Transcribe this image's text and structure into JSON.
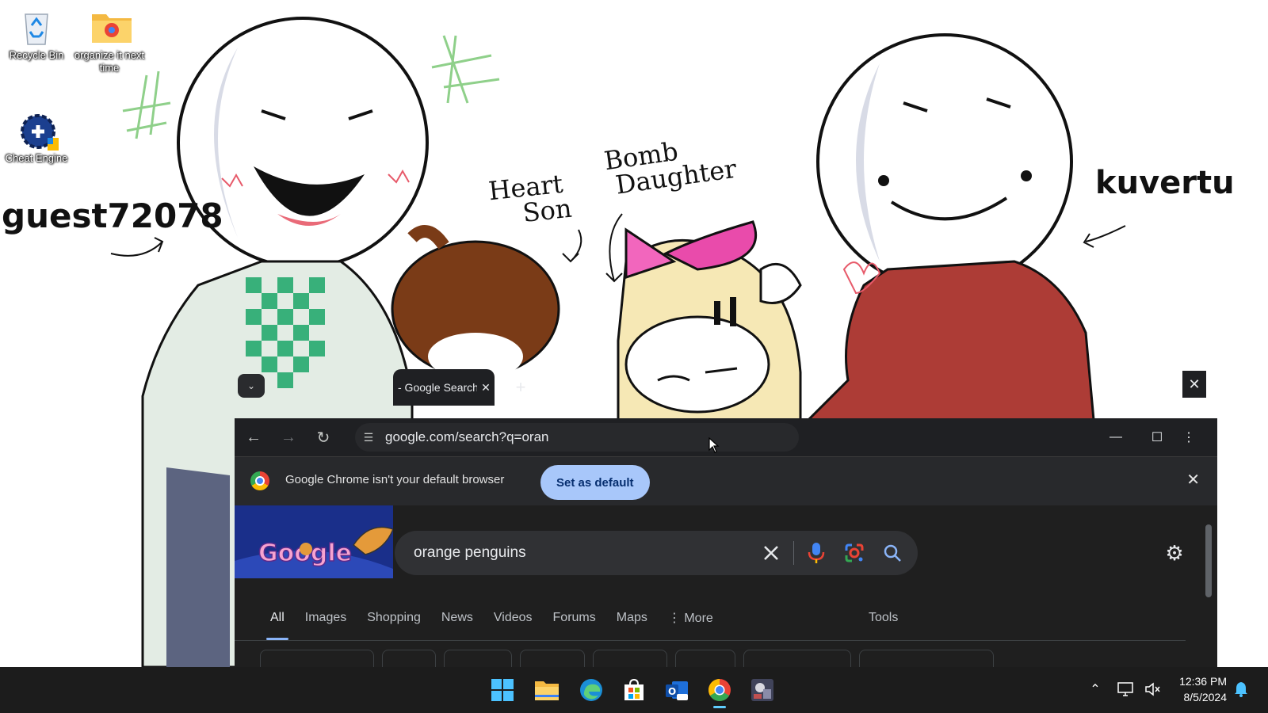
{
  "desktop": {
    "icons": [
      {
        "label": "Recycle Bin",
        "icon": "recycle-bin-icon"
      },
      {
        "label": "organize it next time",
        "icon": "folder-icon"
      },
      {
        "label": "Cheat Engine",
        "icon": "cheat-engine-icon"
      }
    ],
    "wallpaper": {
      "name_left": "guest72078",
      "name_right": "kuvertu",
      "heart_son": [
        "Heart",
        "Son"
      ],
      "bomb_daughter": [
        "Bomb",
        "Daughter"
      ]
    }
  },
  "browser": {
    "tab": {
      "title": "- Google Search",
      "close": "✕"
    },
    "new_tab": "+",
    "address": "google.com/search?q=oran",
    "infobar": {
      "message": "Google Chrome isn't your default browser",
      "button": "Set as default",
      "close": "✕"
    },
    "search": {
      "query": "orange penguins",
      "tabs": [
        "All",
        "Images",
        "Shopping",
        "News",
        "Videos",
        "Forums",
        "Maps",
        "⋮ More"
      ],
      "active_tab": "All",
      "tools": "Tools"
    }
  },
  "taskbar": {
    "apps": [
      "start-icon",
      "file-explorer-icon",
      "edge-icon",
      "store-icon",
      "outlook-icon",
      "chrome-icon",
      "game-icon"
    ],
    "time": "12:36 PM",
    "date": "8/5/2024"
  },
  "colors": {
    "chrome_dark": "#1f2023",
    "infobar_bg": "#28292c",
    "accent_button": "#a8c7fa",
    "taskbar": "#1c1c1c",
    "google_blue": "#8ab4f8"
  }
}
